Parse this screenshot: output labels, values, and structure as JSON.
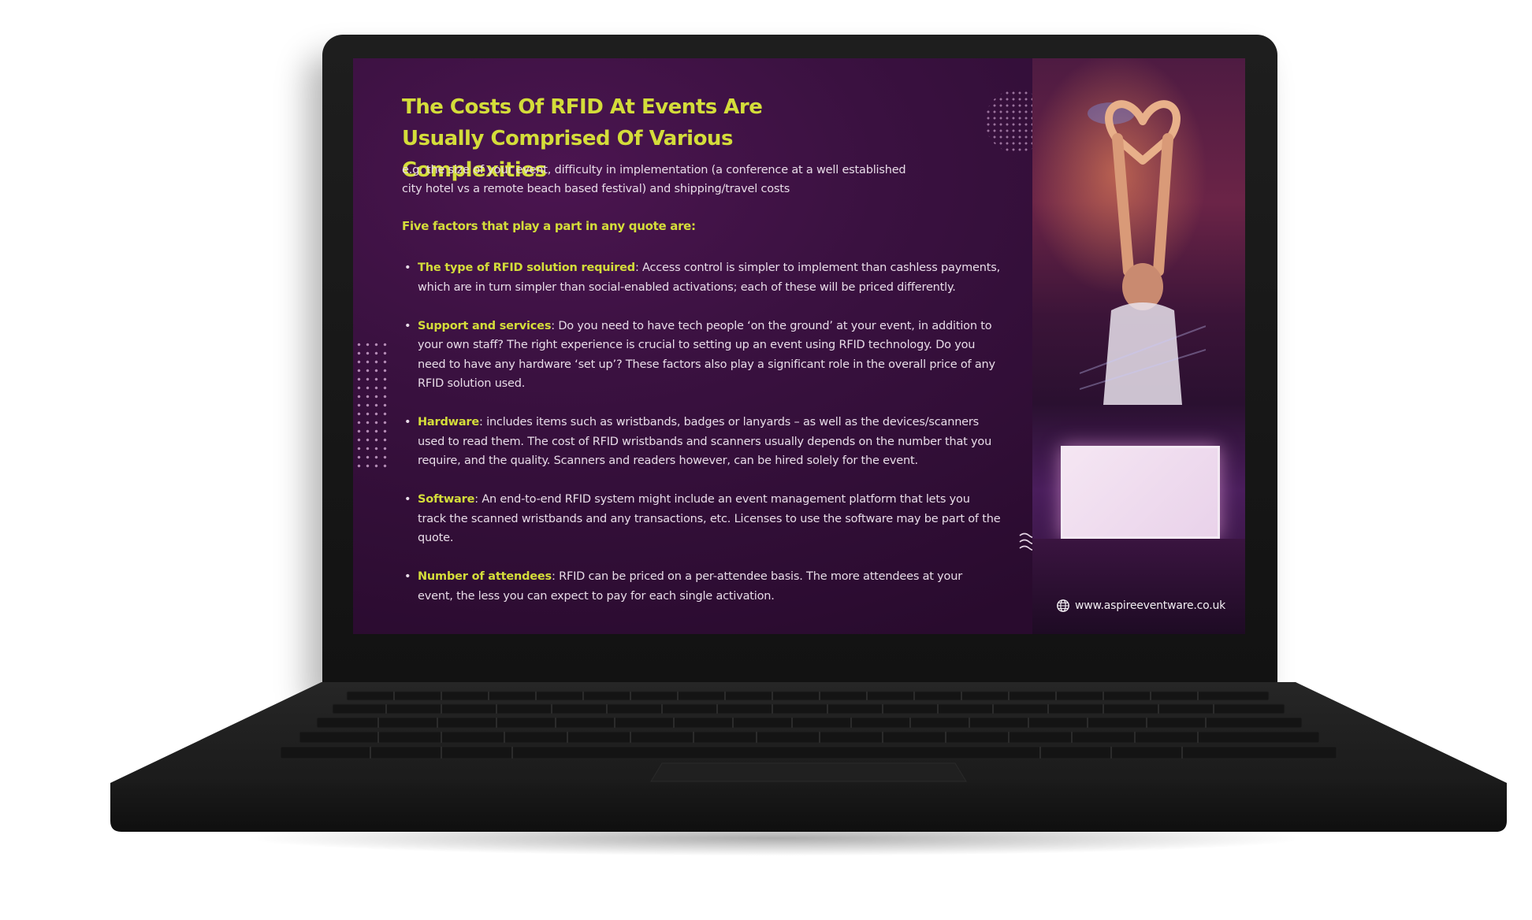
{
  "slide": {
    "title": "The Costs Of RFID At Events Are Usually Comprised Of Various Complexities",
    "intro": "e.g. the size of your event, difficulty in implementation (a conference at a well established city hotel vs a remote beach based festival) and shipping/travel costs",
    "subhead": "Five factors that play a part in any quote are:",
    "factors": [
      {
        "lead": "The type of RFID solution required",
        "text": ": Access control is simpler to implement than cashless payments, which are in turn simpler than social-enabled activations; each of these will be priced differently."
      },
      {
        "lead": "Support and services",
        "text": ": Do you need to have tech people ‘on the ground’ at your event, in addition to your own staff? The right experience is crucial to setting up an event using RFID technology. Do you need to have any hardware ‘set up’? These factors also play a significant role in the overall price of any RFID solution used."
      },
      {
        "lead": "Hardware",
        "text": ": includes items such as wristbands, badges or lanyards – as well as the devices/scanners used to read them. The cost of RFID wristbands and scanners usually depends on the number that you require, and the quality. Scanners and readers however, can  be hired solely for the event."
      },
      {
        "lead": "Software",
        "text": ": An end-to-end RFID system might include an event management platform that lets you track the scanned wristbands and any transactions, etc. Licenses to use the software may be part of the quote."
      },
      {
        "lead": "Number of attendees",
        "text": ": RFID can be priced on a per-attendee basis. The more attendees at your event, the less you can expect to pay for each single activation."
      }
    ],
    "website": "www.aspireeventware.co.uk",
    "website_icon": "globe-icon"
  },
  "colors": {
    "accent": "#d4dd3a",
    "slide_bg": "#3a1140",
    "body_text": "#e8dce8",
    "laptop": "#1a1a1a"
  }
}
